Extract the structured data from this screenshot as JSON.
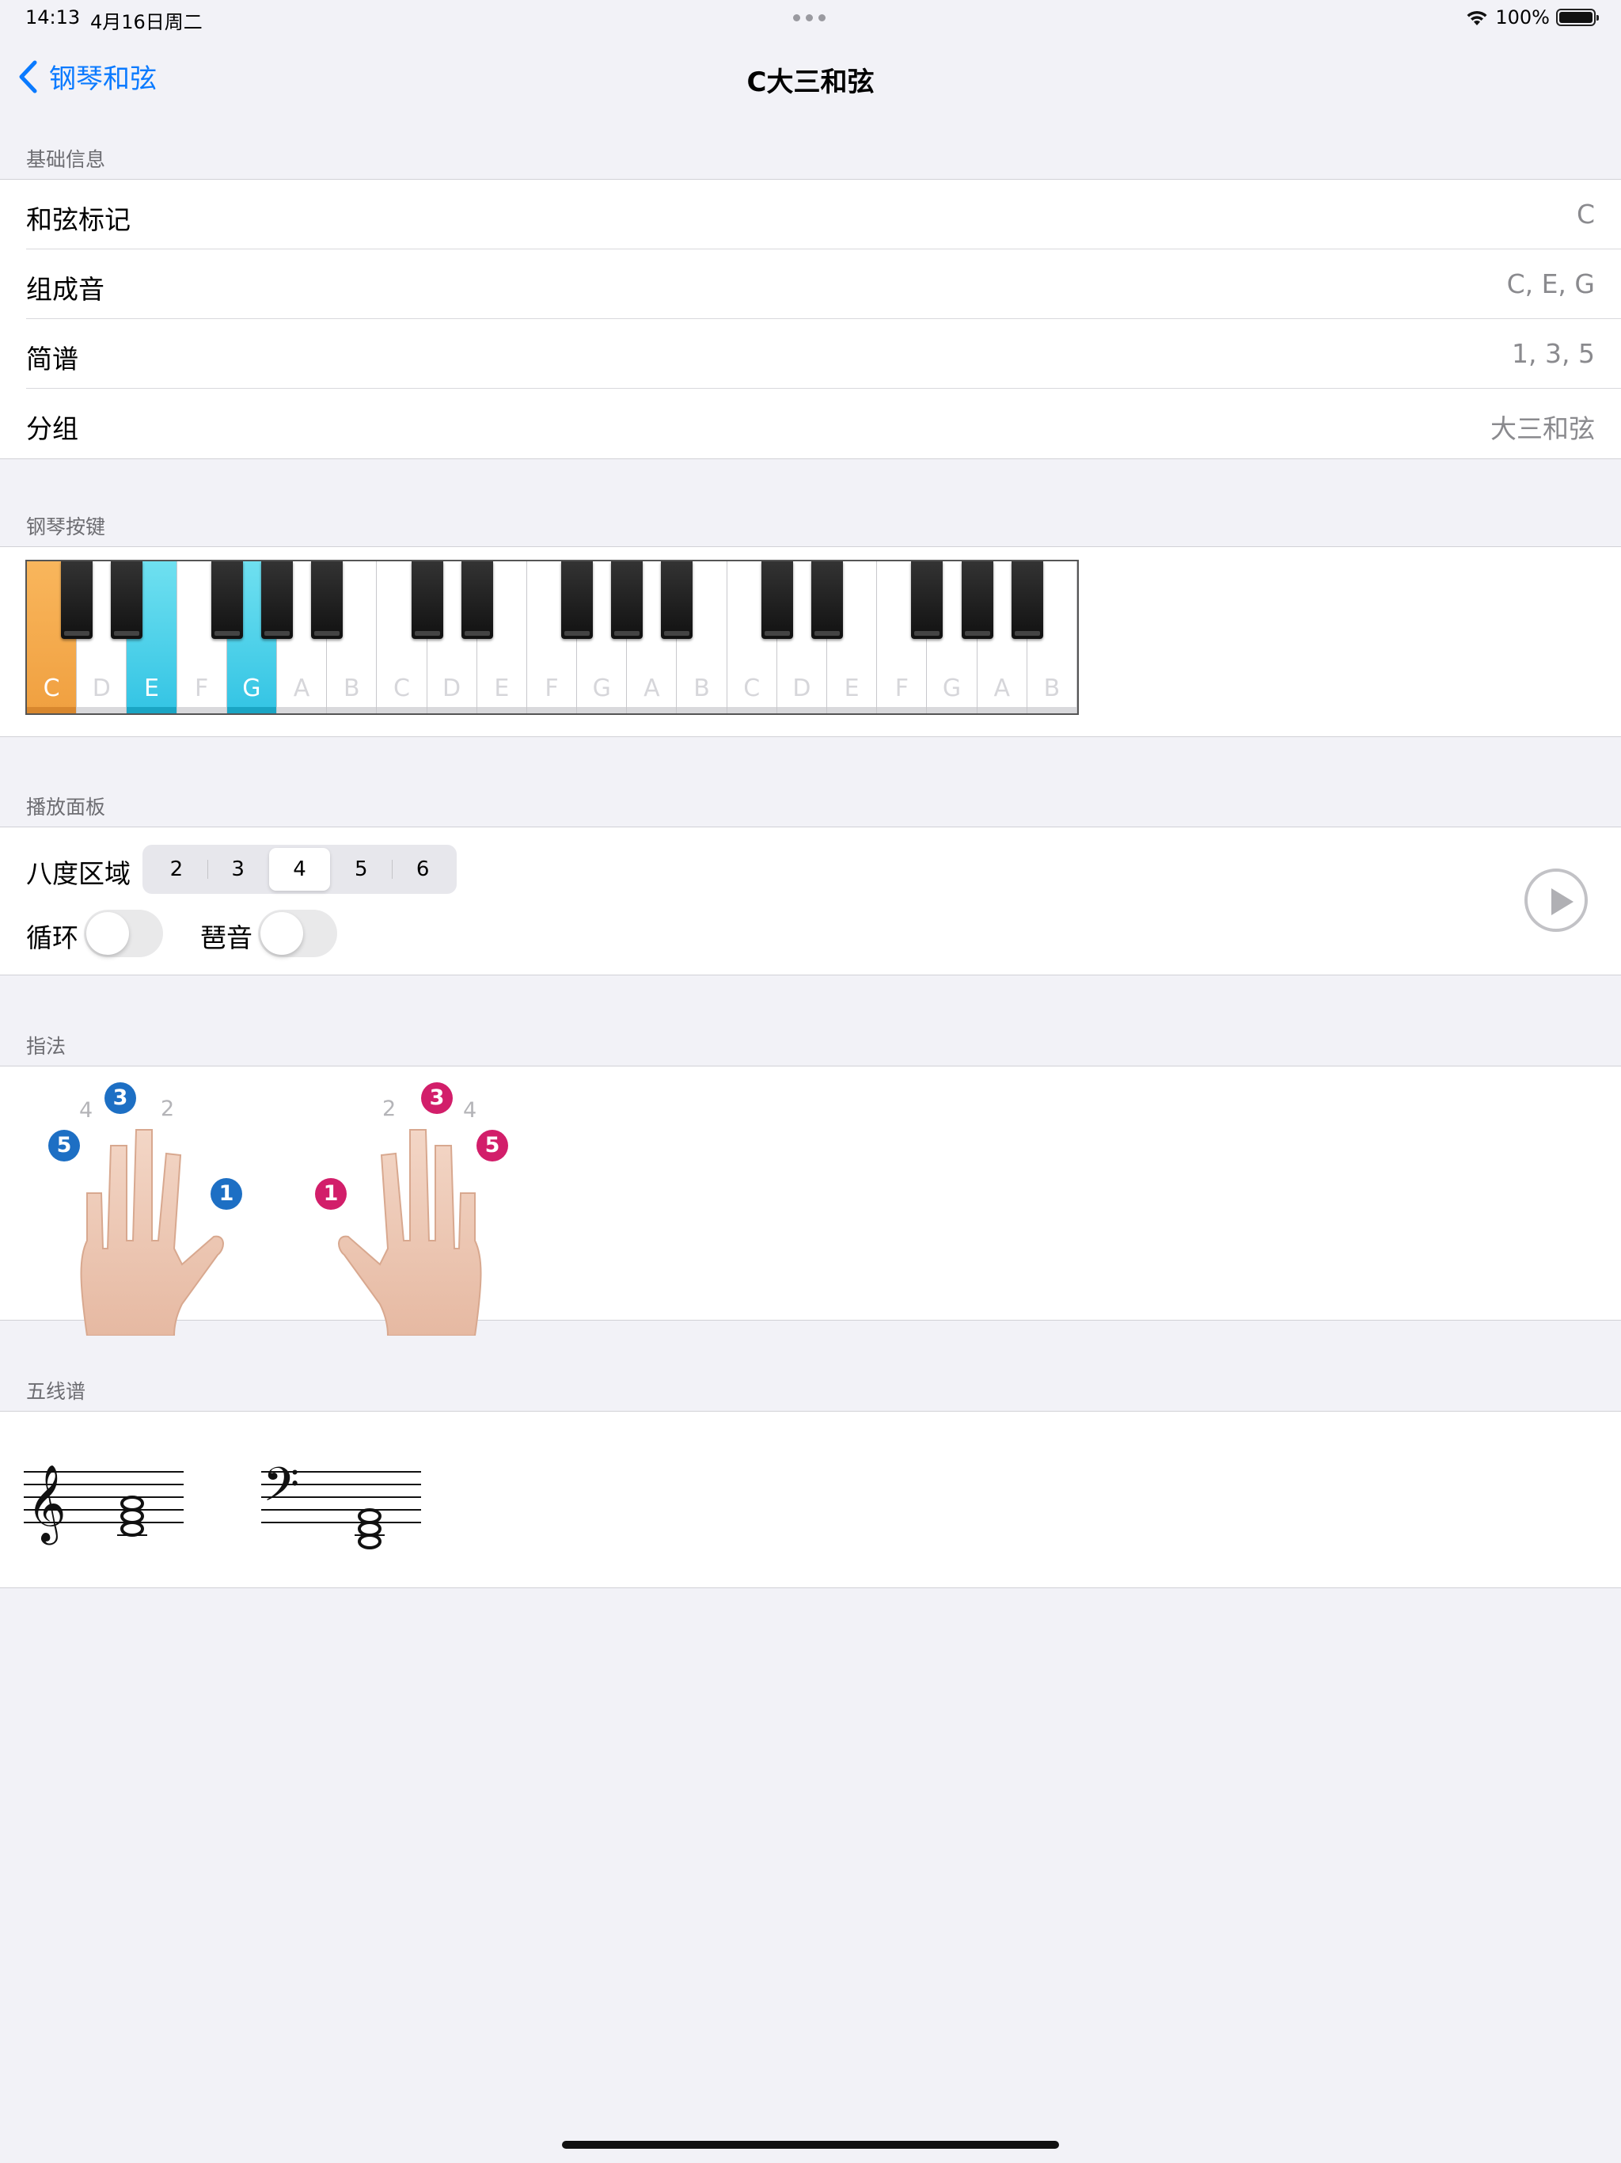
{
  "status": {
    "time": "14:13",
    "date": "4月16日周二",
    "battery": "100%"
  },
  "nav": {
    "back_label": "钢琴和弦",
    "title": "C大三和弦"
  },
  "basic_info": {
    "header": "基础信息",
    "rows": [
      {
        "label": "和弦标记",
        "value": "C"
      },
      {
        "label": "组成音",
        "value": "C, E, G"
      },
      {
        "label": "简谱",
        "value": "1, 3, 5"
      },
      {
        "label": "分组",
        "value": "大三和弦"
      }
    ]
  },
  "piano": {
    "header": "钢琴按键",
    "white_keys": [
      "C",
      "D",
      "E",
      "F",
      "G",
      "A",
      "B",
      "C",
      "D",
      "E",
      "F",
      "G",
      "A",
      "B",
      "C",
      "D",
      "E",
      "F",
      "G",
      "A",
      "B"
    ],
    "root_key_index": 0,
    "chord_key_indices": [
      2,
      4
    ],
    "colors": {
      "root": "#f5a54a",
      "chord": "#4ed2ea"
    }
  },
  "play_panel": {
    "header": "播放面板",
    "octave_label": "八度区域",
    "octaves": [
      "2",
      "3",
      "4",
      "5",
      "6"
    ],
    "selected_octave": "4",
    "loop_label": "循环",
    "loop_on": false,
    "arpeggio_label": "琶音",
    "arpeggio_on": false
  },
  "fingering": {
    "header": "指法",
    "left_hand": {
      "inactive": [
        "4",
        "2"
      ],
      "active": [
        "5",
        "3",
        "1"
      ],
      "color": "#1d6fc4"
    },
    "right_hand": {
      "inactive": [
        "2",
        "4"
      ],
      "active": [
        "1",
        "3",
        "5"
      ],
      "color": "#d21e6a"
    }
  },
  "staff": {
    "header": "五线谱",
    "clefs": [
      "treble-clef",
      "bass-clef"
    ],
    "notes": [
      "C",
      "E",
      "G"
    ]
  },
  "colors": {
    "accent": "#0a7aff",
    "background": "#f2f2f7"
  }
}
